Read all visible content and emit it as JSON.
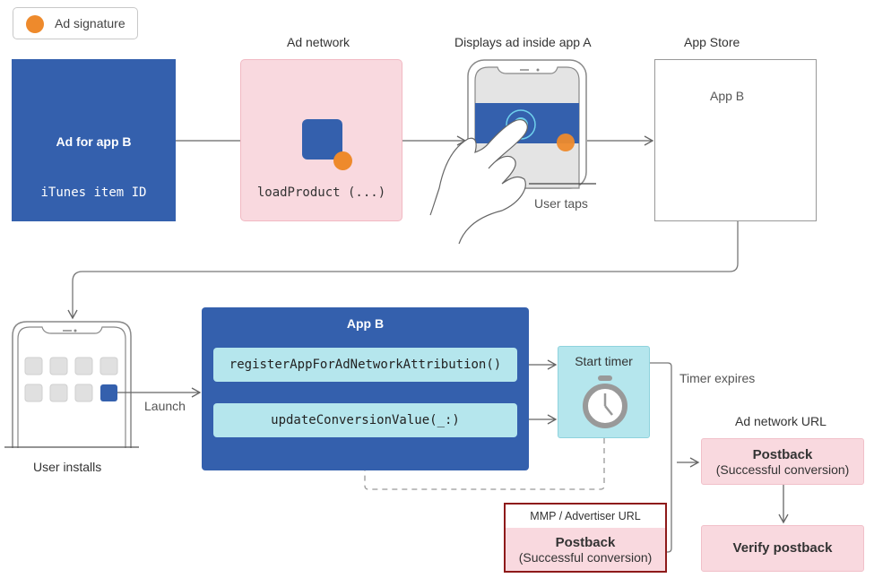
{
  "legend": {
    "icon": "orange-dot-icon",
    "label": "Ad signature"
  },
  "colors": {
    "ad_signature": "#ee8a2c",
    "app_blue": "#3460ad",
    "light_cyan": "#b5e6ed",
    "pink": "#f9d9df",
    "highlight_border": "#8e1a1a"
  },
  "ad_for_app": {
    "title": "Ad for app B",
    "subtitle": "iTunes item ID"
  },
  "ad_network": {
    "heading": "Ad network",
    "code": "loadProduct (...)"
  },
  "display_ad": {
    "heading": "Displays ad inside app A",
    "caption": "User taps"
  },
  "app_store": {
    "heading": "App Store",
    "app_name": "App B"
  },
  "install": {
    "caption": "User installs",
    "launch_label": "Launch"
  },
  "app_b": {
    "title": "App B",
    "methods": [
      "registerAppForAdNetworkAttribution()",
      "updateConversionValue(_:)"
    ]
  },
  "timer": {
    "title": "Start timer",
    "expires_label": "Timer expires",
    "icon": "stopwatch-icon"
  },
  "ad_network_url": {
    "heading": "Ad network URL",
    "postback_title": "Postback",
    "postback_sub": "(Successful conversion)",
    "verify": "Verify postback"
  },
  "mmp": {
    "heading": "MMP / Advertiser URL",
    "postback_title": "Postback",
    "postback_sub": "(Successful conversion)"
  }
}
